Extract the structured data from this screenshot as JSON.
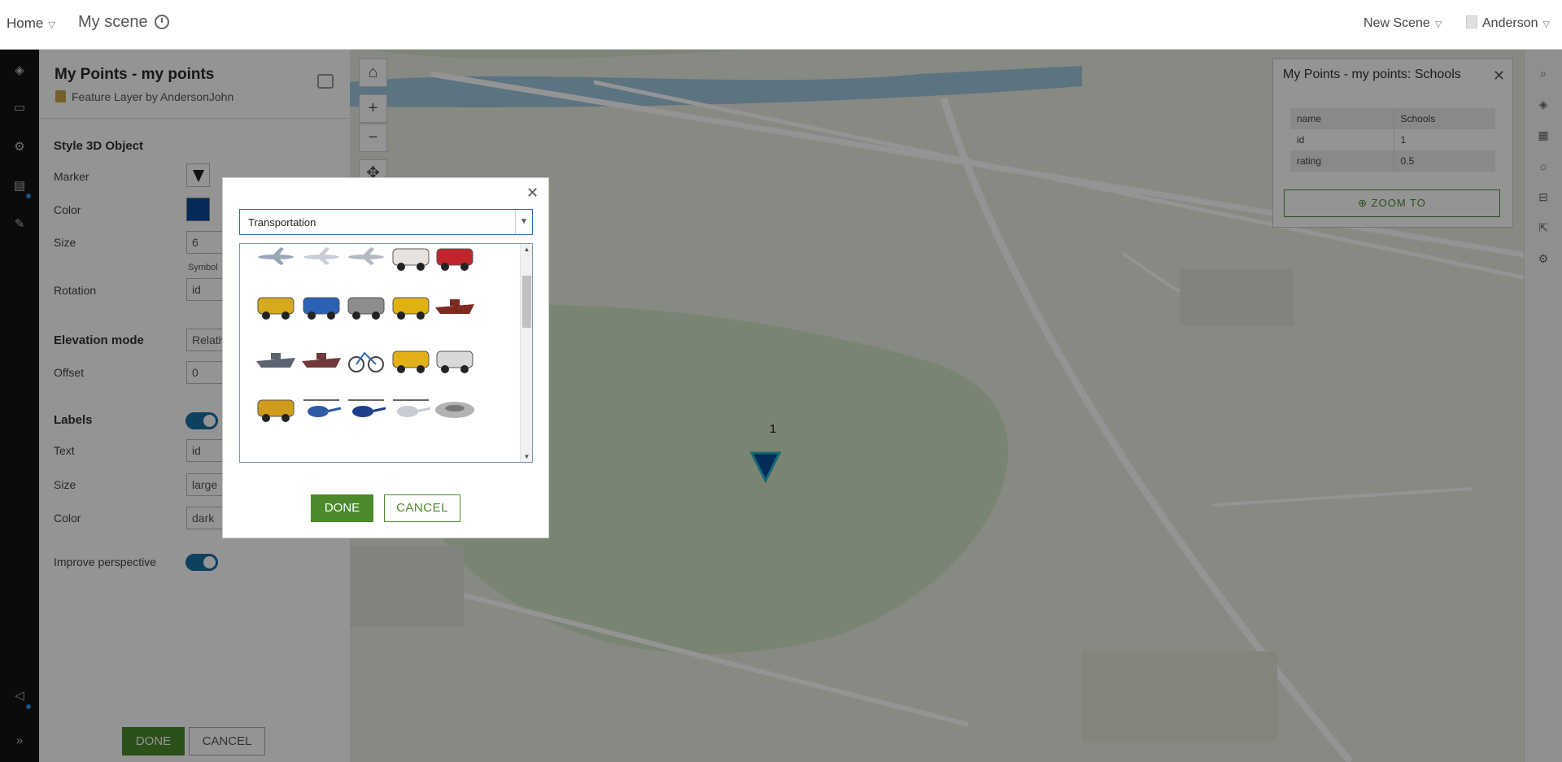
{
  "header": {
    "home_label": "Home",
    "scene_title": "My scene",
    "new_scene_label": "New Scene",
    "user_name": "Anderson"
  },
  "panel": {
    "title": "My Points - my points",
    "subtitle": "Feature Layer by AndersonJohn",
    "style_section": "Style 3D Object",
    "marker_label": "Marker",
    "color_label": "Color",
    "size_label": "Size",
    "size_value": "6",
    "symbol_note": "Symbol",
    "rotation_label": "Rotation",
    "rotation_value": "id",
    "elevation_section": "Elevation mode",
    "elevation_value": "Relative",
    "offset_label": "Offset",
    "offset_value": "0",
    "labels_section": "Labels",
    "labels_on": true,
    "text_label": "Text",
    "text_value": "id",
    "label_size_label": "Size",
    "label_size_value": "large",
    "label_color_label": "Color",
    "label_color_value": "dark",
    "perspective_label": "Improve perspective",
    "perspective_on": true,
    "done_label": "DONE",
    "cancel_label": "CANCEL",
    "marker_color": "#0a4b9a"
  },
  "popup": {
    "title": "My Points - my points: Schools",
    "rows": [
      {
        "key": "name",
        "value": "Schools"
      },
      {
        "key": "id",
        "value": "1"
      },
      {
        "key": "rating",
        "value": "0.5"
      }
    ],
    "zoom_label": "ZOOM TO"
  },
  "map": {
    "point_label": "1"
  },
  "dialog": {
    "category_value": "Transportation",
    "done_label": "DONE",
    "cancel_label": "CANCEL",
    "items": [
      "airplane-small",
      "jet-white",
      "jet-grey",
      "ambulance",
      "red-car",
      "backhoe-loader",
      "blue-sedan",
      "skid-steer",
      "yellow-bus",
      "shipping-container",
      "ship-grey",
      "ship-red",
      "bicycle",
      "crane-truck",
      "box-truck",
      "dump-truck",
      "helicopter-blue",
      "helicopter-navy",
      "helicopter-white",
      "helicopter-pad"
    ]
  }
}
